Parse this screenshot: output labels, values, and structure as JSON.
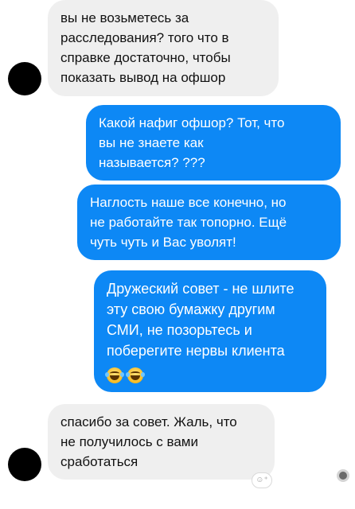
{
  "messages": [
    {
      "side": "incoming",
      "lines": [
        "вы не возьметесь за",
        "расследования? того что в",
        "справке достаточно, чтобы",
        "показать вывод на офшор"
      ]
    },
    {
      "side": "outgoing",
      "lines": [
        "Какой нафиг офшор? Тот, что",
        "вы не знаете как",
        "называется? ???"
      ]
    },
    {
      "side": "outgoing",
      "lines": [
        "Наглость наше все конечно, но",
        "не работайте так топорно. Ещё",
        "чуть чуть и Вас уволят!"
      ]
    },
    {
      "side": "outgoing",
      "lines": [
        "Дружеский совет - не шлите",
        "эту свою бумажку другим",
        "СМИ, не позорьтесь и",
        "поберегите нервы клиента"
      ],
      "emoji": [
        "face-with-tears-of-joy-icon",
        "face-with-tears-of-joy-icon"
      ]
    },
    {
      "side": "incoming",
      "lines": [
        "спасибо за совет. Жаль, что",
        "не получилось с вами",
        "сработаться"
      ]
    }
  ],
  "reaction_button": {
    "icon": "add-reaction-icon",
    "glyph": "☺⁺"
  },
  "colors": {
    "outgoing_bubble": "#0d88f5",
    "incoming_bubble": "#efefef",
    "avatar": "#000000"
  }
}
